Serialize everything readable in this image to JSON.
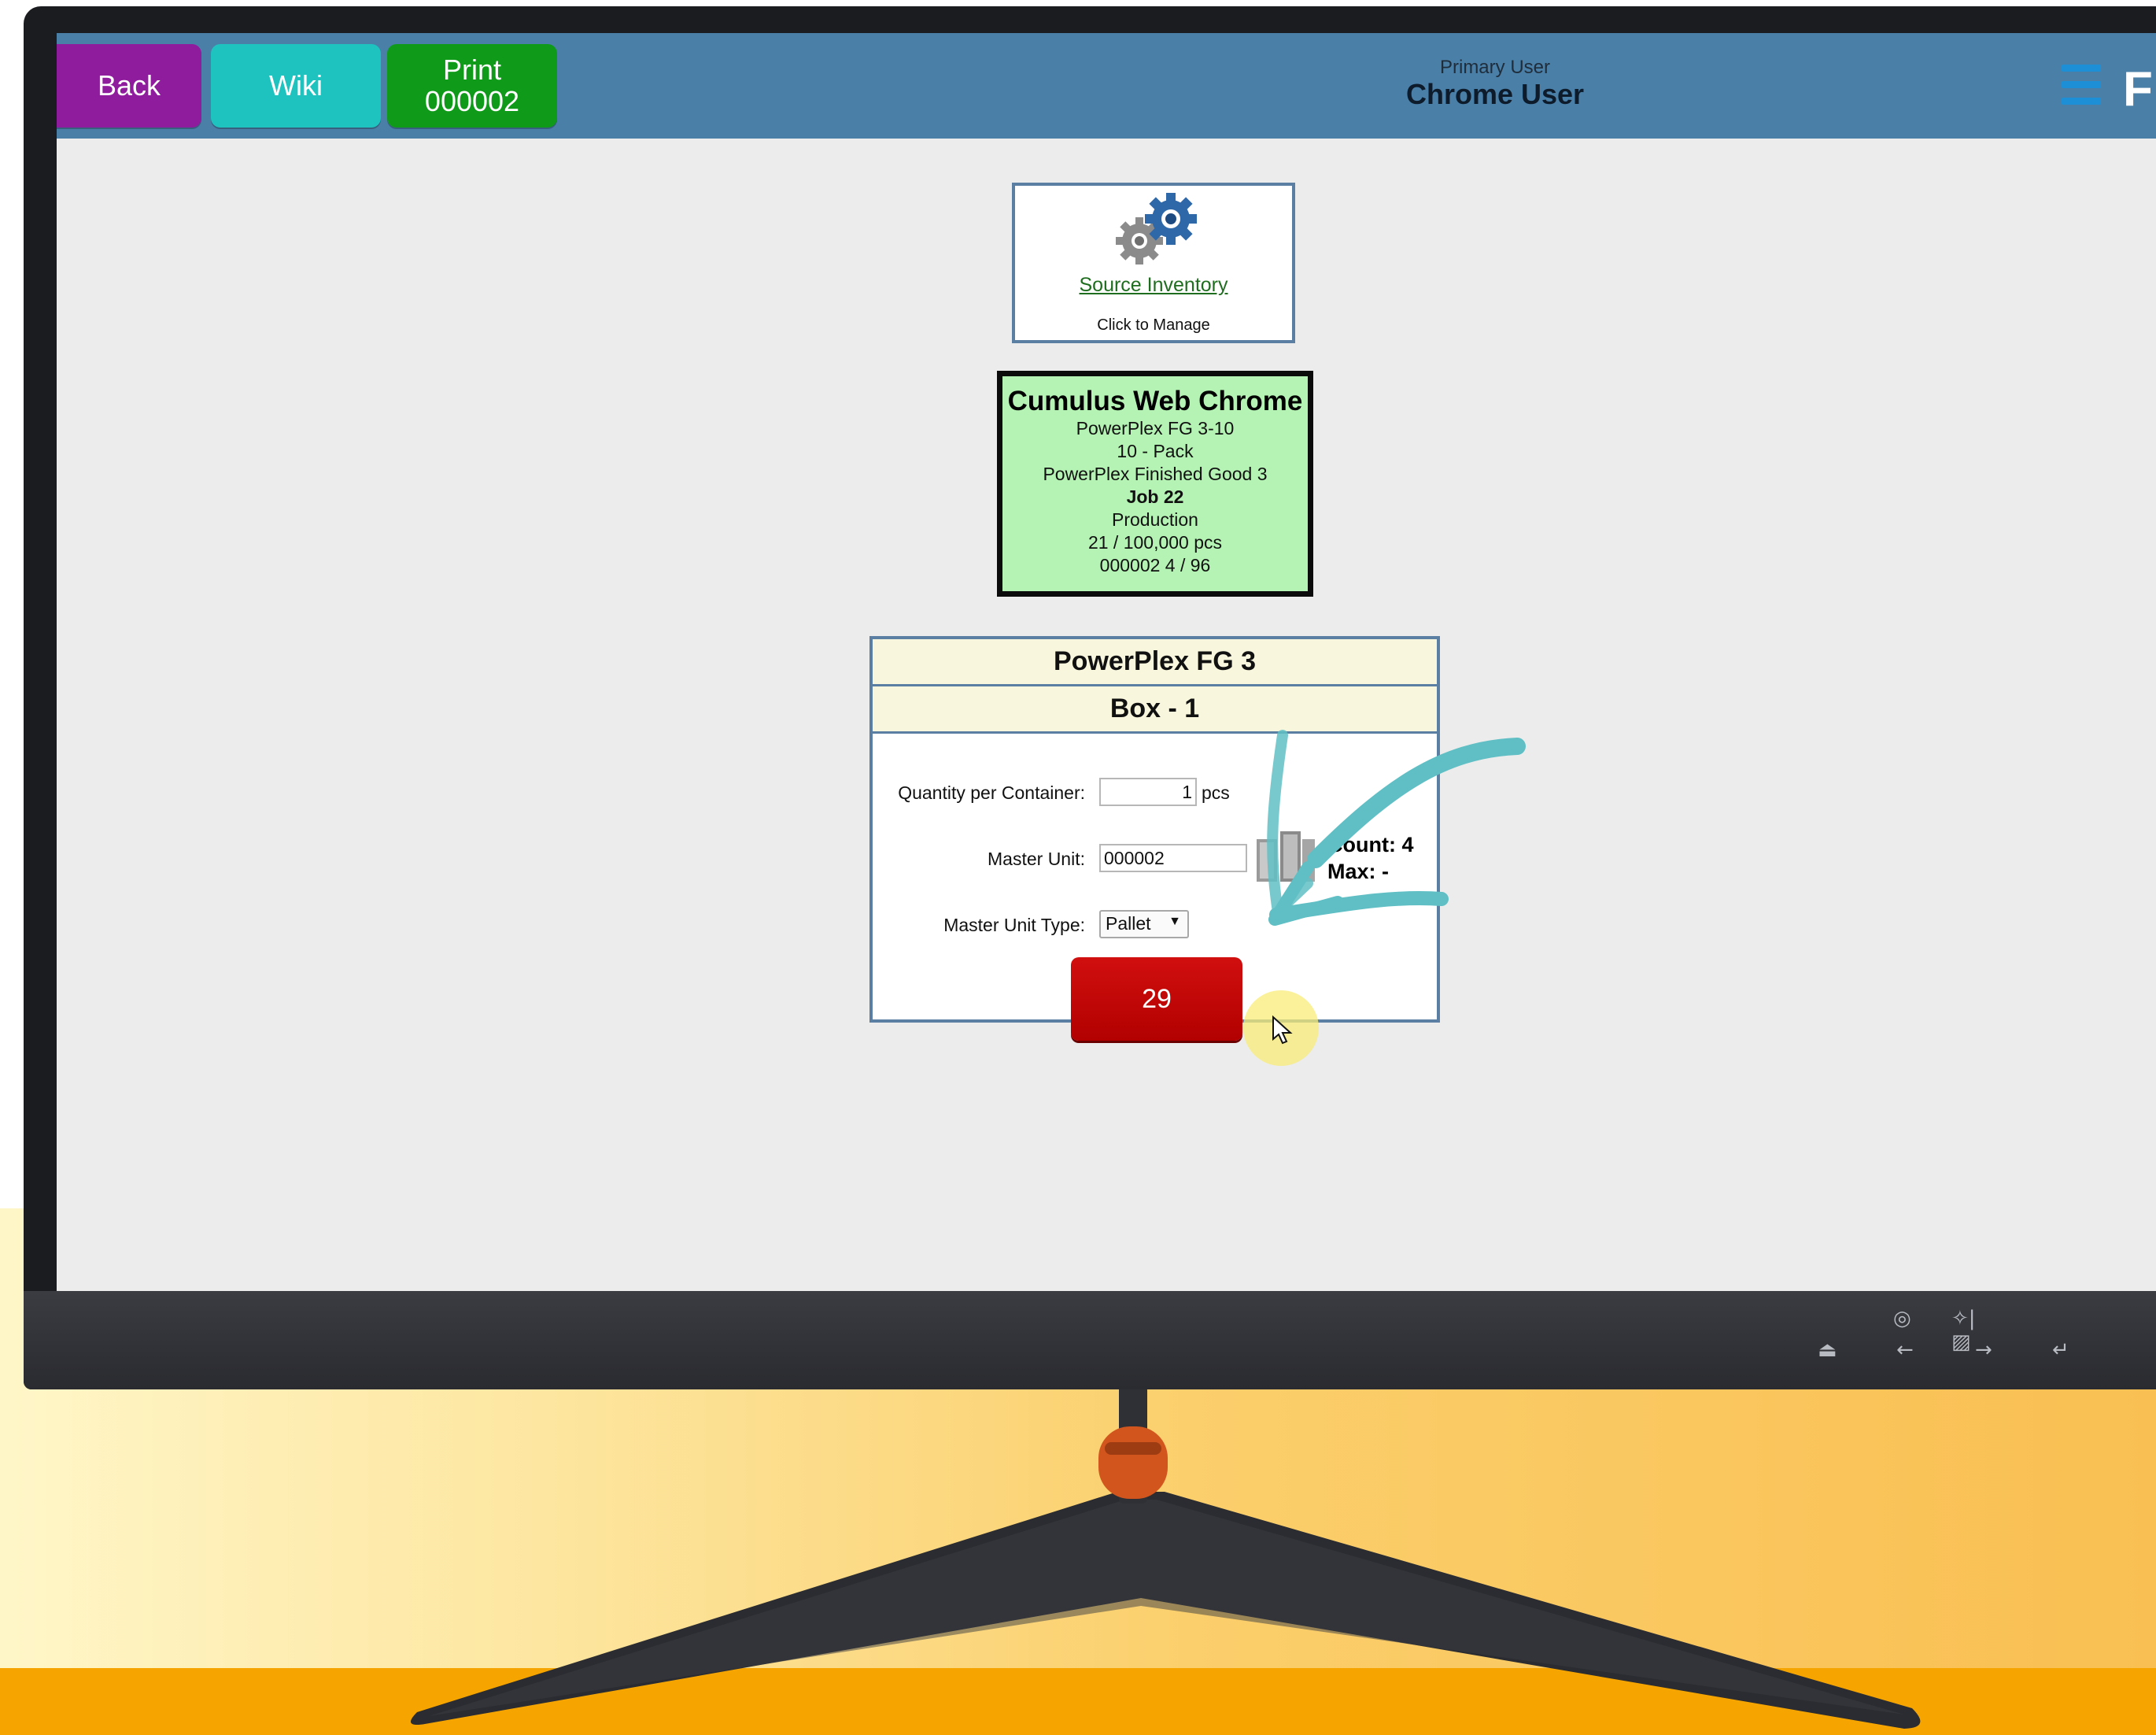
{
  "topbar": {
    "back_label": "Back",
    "wiki_label": "Wiki",
    "print_label_line1": "Print",
    "print_label_line2": "000002",
    "user_role": "Primary User",
    "user_name": "Chrome User",
    "brand_letter": "F"
  },
  "source_inventory": {
    "link_text": "Source Inventory",
    "sub_text": "Click to Manage",
    "icon": "gears-icon"
  },
  "job_card": {
    "title": "Cumulus Web Chrome",
    "lines": [
      "PowerPlex FG 3-10",
      "10 - Pack",
      "PowerPlex Finished Good 3",
      "Job 22",
      "Production",
      "21 / 100,000 pcs",
      "000002 4 / 96"
    ]
  },
  "panel": {
    "product": "PowerPlex FG 3",
    "container": "Box - 1",
    "qty_label": "Quantity per Container:",
    "qty_value": "1",
    "qty_unit": "pcs",
    "master_unit_label": "Master Unit:",
    "master_unit_value": "000002",
    "master_type_label": "Master Unit Type:",
    "master_type_value": "Pallet",
    "count_text": "Count: 4",
    "max_text": "Max: -",
    "action_value": "29"
  },
  "colors": {
    "topbar": "#4a7fa8",
    "back": "#8e1c9c",
    "wiki": "#1ec3c0",
    "print": "#109a1a",
    "job_card": "#b4f3b4",
    "action": "#c20606",
    "annotation_arrow": "#5fbfc4"
  }
}
